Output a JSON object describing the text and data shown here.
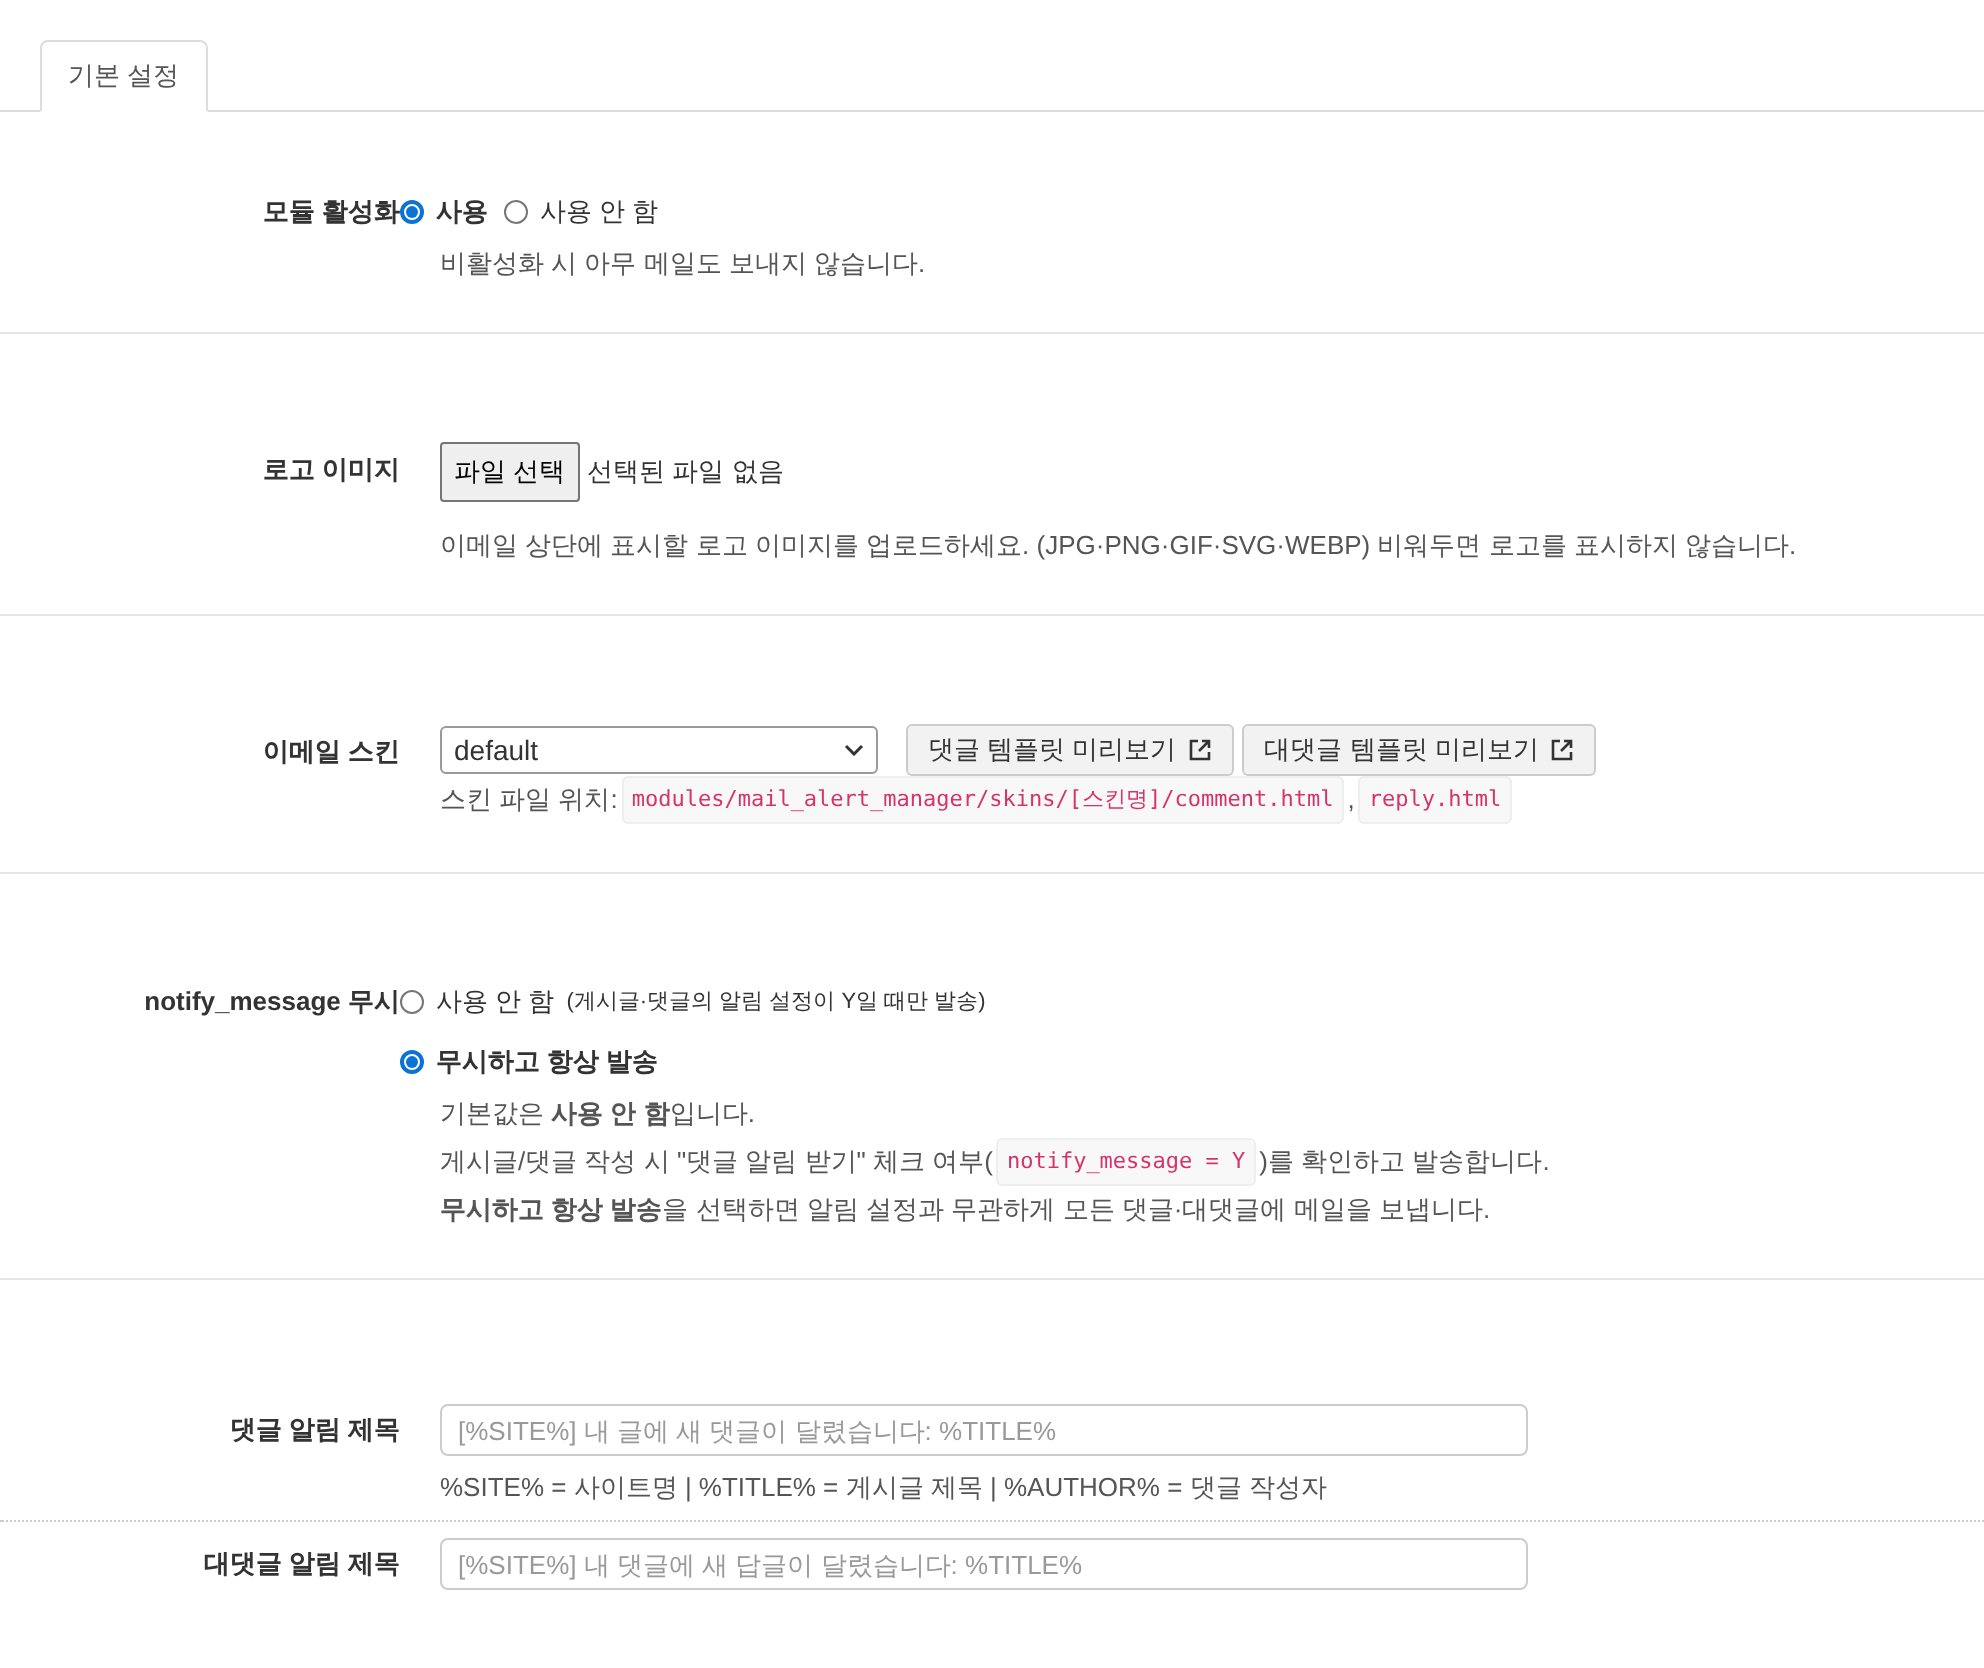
{
  "tabs": [
    {
      "label": "기본 설정",
      "selected": true
    }
  ],
  "sections": [
    {
      "kind": "radio",
      "label": "모듈 활성화",
      "options": [
        {
          "label": "사용",
          "selected": true
        },
        {
          "label": "사용 안 함",
          "selected": false
        }
      ],
      "hints": [
        [
          {
            "kind": "text",
            "text": "비활성화 시 아무 메일도 보내지 않습니다."
          }
        ]
      ]
    },
    {
      "kind": "file",
      "label": "로고 이미지",
      "button": "파일 선택",
      "status": "선택된 파일 없음",
      "hints": [
        [
          {
            "kind": "text",
            "text": "이메일 상단에 표시할 로고 이미지를 업로드하세요. (JPG·PNG·GIF·SVG·WEBP) 비워두면 로고를 표시하지 않습니다."
          }
        ]
      ]
    },
    {
      "kind": "select",
      "label": "이메일 스킨",
      "value": "default",
      "buttons": [
        "댓글 템플릿 미리보기",
        "대댓글 템플릿 미리보기"
      ],
      "hints": [
        [
          {
            "kind": "text",
            "text": "스킨 파일 위치:"
          },
          {
            "kind": "code",
            "text": "modules/mail_alert_manager/skins/[스킨명]/comment.html"
          },
          {
            "kind": "text",
            "text": ","
          },
          {
            "kind": "code",
            "text": "reply.html"
          }
        ]
      ]
    },
    {
      "kind": "radio-stacked",
      "label": "notify_message 무시",
      "options": [
        {
          "label": "사용 안 함",
          "note": "(게시글·댓글의 알림 설정이 Y일 때만 발송)",
          "selected": false
        },
        {
          "label": "무시하고 항상 발송",
          "selected": true
        }
      ],
      "hints": [
        [
          {
            "kind": "text",
            "text": "기본값은 **사용 안 함**입니다."
          }
        ],
        [
          {
            "kind": "text",
            "text": "게시글/댓글 작성 시 \"댓글 알림 받기\" 체크 여부("
          },
          {
            "kind": "code",
            "text": "notify_message = Y"
          },
          {
            "kind": "text",
            "text": ")를 확인하고 발송합니다."
          }
        ],
        [
          {
            "kind": "text",
            "text": "**무시하고 항상 발송**을 선택하면 알림 설정과 무관하게 모든 댓글·대댓글에 메일을 보냅니다."
          }
        ]
      ]
    },
    {
      "kind": "texts",
      "fields": [
        {
          "label": "댓글 알림 제목",
          "placeholder": "[%SITE%] 내 글에 새 댓글이 달렸습니다: %TITLE%",
          "hints": [
            [
              {
                "kind": "text",
                "text": "%SITE% = 사이트명  |  %TITLE% = 게시글 제목  |  %AUTHOR% = 댓글 작성자"
              }
            ]
          ]
        },
        {
          "label": "대댓글 알림 제목",
          "placeholder": "[%SITE%] 내 댓글에 새 답글이 달렸습니다: %TITLE%"
        }
      ]
    }
  ]
}
